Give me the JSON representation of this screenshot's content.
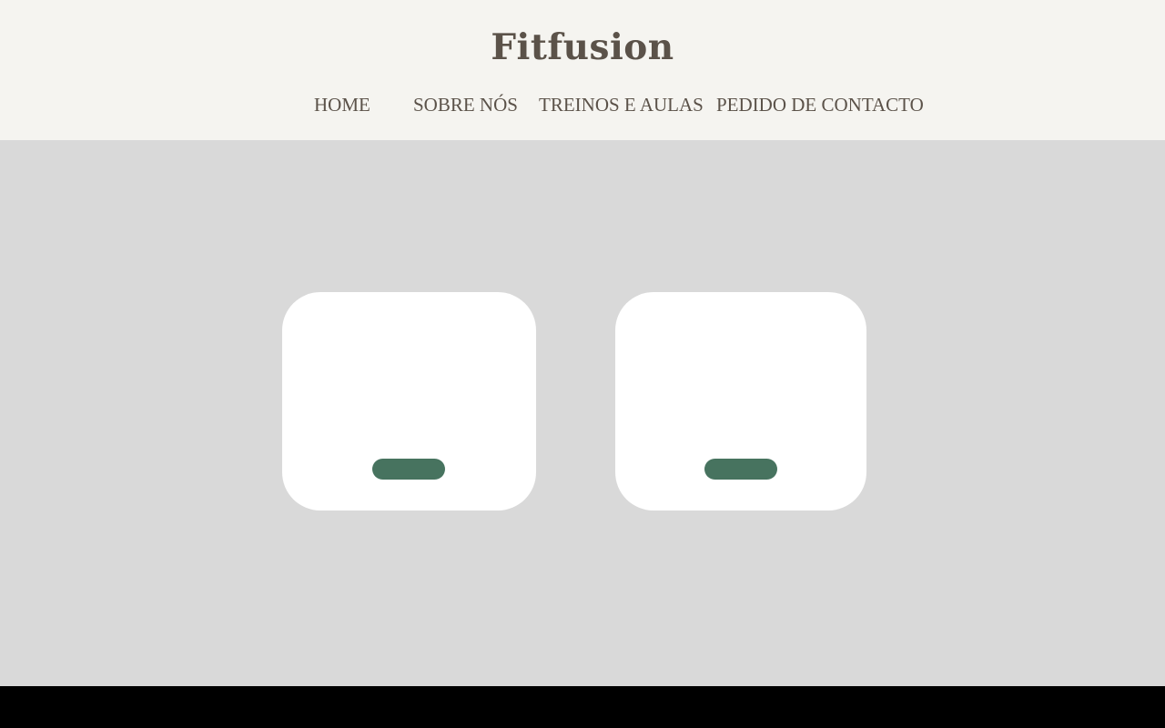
{
  "header": {
    "title": "Fitfusion",
    "background": "#f5f4f0",
    "text_color": "#5b5249"
  },
  "nav": {
    "items": [
      {
        "label": "HOME"
      },
      {
        "label": "SOBRE NÓS"
      },
      {
        "label": "TREINOS E AULAS"
      },
      {
        "label": "PEDIDO DE CONTACTO"
      }
    ]
  },
  "main": {
    "background": "#d9d9d9",
    "cards": [
      {
        "button_label": "",
        "button_color": "#47735f"
      },
      {
        "button_label": "",
        "button_color": "#47735f"
      }
    ]
  },
  "footer": {
    "background": "#000000"
  }
}
